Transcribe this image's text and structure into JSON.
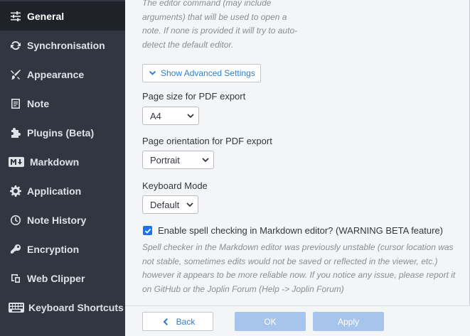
{
  "sidebar": {
    "items": [
      {
        "label": "General",
        "icon": "sliders-icon",
        "selected": true
      },
      {
        "label": "Synchronisation",
        "icon": "sync-icon"
      },
      {
        "label": "Appearance",
        "icon": "paint-brush-icon"
      },
      {
        "label": "Note",
        "icon": "note-icon"
      },
      {
        "label": "Plugins (Beta)",
        "icon": "puzzle-icon"
      },
      {
        "label": "Markdown",
        "icon": "markdown-icon"
      },
      {
        "label": "Application",
        "icon": "gear-icon"
      },
      {
        "label": "Note History",
        "icon": "history-icon"
      },
      {
        "label": "Encryption",
        "icon": "key-icon"
      },
      {
        "label": "Web Clipper",
        "icon": "clipper-icon"
      },
      {
        "label": "Keyboard Shortcuts",
        "icon": "keyboard-icon"
      }
    ]
  },
  "main": {
    "editor_desc": [
      "The editor command (may include",
      "arguments) that will be used to open a",
      "note. If none is provided it will try to auto-",
      "detect the default editor."
    ],
    "advanced_button": "Show Advanced Settings",
    "page_size_label": "Page size for PDF export",
    "page_size_value": "A4",
    "orientation_label": "Page orientation for PDF export",
    "orientation_value": "Portrait",
    "keyboard_mode_label": "Keyboard Mode",
    "keyboard_mode_value": "Default",
    "spellcheck_checked": true,
    "spellcheck_label": "Enable spell checking in Markdown editor? (WARNING BETA feature)",
    "spellcheck_desc": [
      "Spell checker in the Markdown editor was previously unstable (cursor location was",
      "not stable, sometimes edits would not be saved or reflected in the viewer, etc.)",
      "however it appears to be more reliable now. If you notice any issue, please report it",
      "on GitHub or the Joplin Forum (Help -> Joplin Forum)"
    ]
  },
  "footer": {
    "back_label": "Back",
    "ok_label": "OK",
    "apply_label": "Apply"
  },
  "colors": {
    "sidebar_bg": "#313640",
    "sidebar_selected": "#1f2228",
    "accent": "#2e7fd3",
    "disabled_button": "#a7c4ec",
    "content_bg": "#f4f5f6"
  }
}
